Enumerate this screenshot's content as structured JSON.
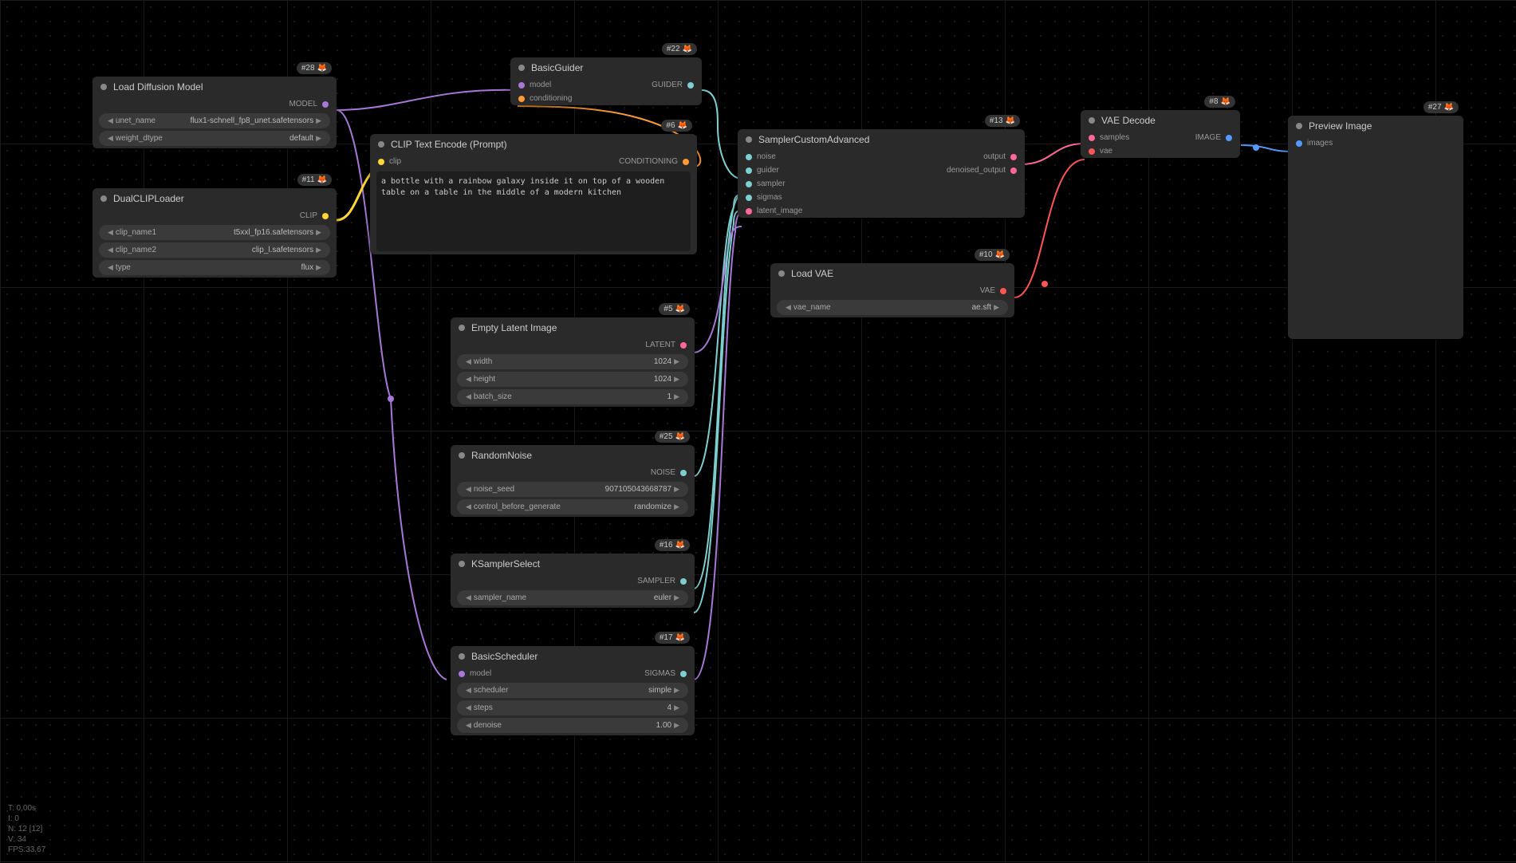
{
  "stats": {
    "t": "T: 0.00s",
    "i": "I: 0",
    "n": "N: 12 [12]",
    "v": "V: 34",
    "fps": "FPS:33,67"
  },
  "nodes": {
    "loadDiffusion": {
      "badge": "#28",
      "title": "Load Diffusion Model",
      "out": "MODEL",
      "w1_label": "unet_name",
      "w1_value": "flux1-schnell_fp8_unet.safetensors",
      "w2_label": "weight_dtype",
      "w2_value": "default"
    },
    "dualClip": {
      "badge": "#11",
      "title": "DualCLIPLoader",
      "out": "CLIP",
      "w1_label": "clip_name1",
      "w1_value": "t5xxl_fp16.safetensors",
      "w2_label": "clip_name2",
      "w2_value": "clip_l.safetensors",
      "w3_label": "type",
      "w3_value": "flux"
    },
    "clipText": {
      "badge": "#6",
      "title": "CLIP Text Encode (Prompt)",
      "out": "CONDITIONING",
      "in": "clip",
      "text": "a bottle with a rainbow galaxy inside it on top of a wooden table on a table in the middle of a modern kitchen"
    },
    "basicGuider": {
      "badge": "#22",
      "title": "BasicGuider",
      "out": "GUIDER",
      "in1": "model",
      "in2": "conditioning"
    },
    "emptyLatent": {
      "badge": "#5",
      "title": "Empty Latent Image",
      "out": "LATENT",
      "w1_label": "width",
      "w1_value": "1024",
      "w2_label": "height",
      "w2_value": "1024",
      "w3_label": "batch_size",
      "w3_value": "1"
    },
    "randomNoise": {
      "badge": "#25",
      "title": "RandomNoise",
      "out": "NOISE",
      "w1_label": "noise_seed",
      "w1_value": "907105043668787",
      "w2_label": "control_before_generate",
      "w2_value": "randomize"
    },
    "ksampler": {
      "badge": "#16",
      "title": "KSamplerSelect",
      "out": "SAMPLER",
      "w1_label": "sampler_name",
      "w1_value": "euler"
    },
    "scheduler": {
      "badge": "#17",
      "title": "BasicScheduler",
      "out": "SIGMAS",
      "in": "model",
      "w1_label": "scheduler",
      "w1_value": "simple",
      "w2_label": "steps",
      "w2_value": "4",
      "w3_label": "denoise",
      "w3_value": "1.00"
    },
    "sampler": {
      "badge": "#13",
      "title": "SamplerCustomAdvanced",
      "in1": "noise",
      "in2": "guider",
      "in3": "sampler",
      "in4": "sigmas",
      "in5": "latent_image",
      "out1": "output",
      "out2": "denoised_output"
    },
    "loadVae": {
      "badge": "#10",
      "title": "Load VAE",
      "out": "VAE",
      "w1_label": "vae_name",
      "w1_value": "ae.sft"
    },
    "vaeDecode": {
      "badge": "#8",
      "title": "VAE Decode",
      "out": "IMAGE",
      "in1": "samples",
      "in2": "vae"
    },
    "preview": {
      "badge": "#27",
      "title": "Preview Image",
      "in": "images"
    }
  }
}
